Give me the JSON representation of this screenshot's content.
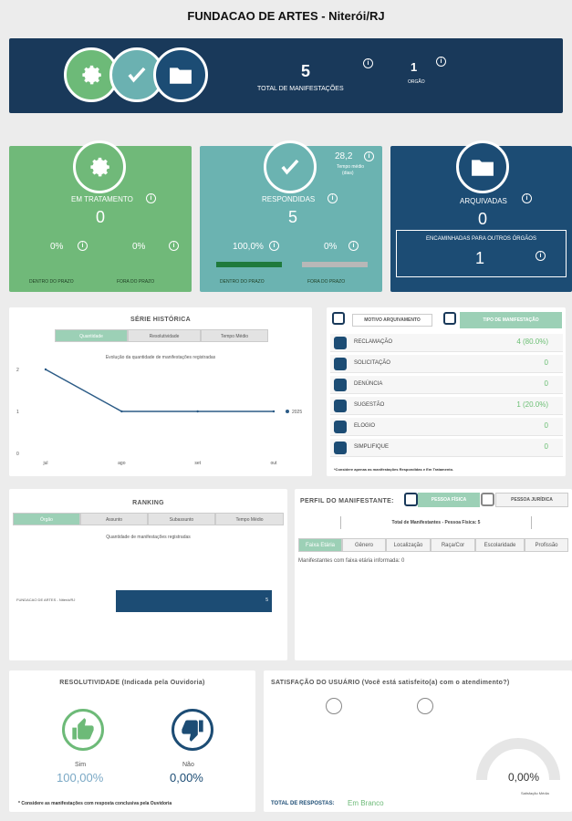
{
  "page_title": "FUNDACAO DE ARTES - Niterói/RJ",
  "header": {
    "total_value": "5",
    "total_label": "TOTAL DE MANIFESTAÇÕES",
    "orgao_value": "1",
    "orgao_label": "ORGÃO",
    "info_glyph": "i"
  },
  "cards": {
    "tratamento": {
      "label": "EM TRATAMENTO",
      "value": "0",
      "pct_dentro": "0%",
      "pct_fora": "0%",
      "dentro_label": "DENTRO DO PRAZO",
      "fora_label": "FORA DO PRAZO"
    },
    "respondidas": {
      "label": "RESPONDIDAS",
      "value": "5",
      "tempo_value": "28,2",
      "tempo_label": "Tempo médio",
      "tempo_unit": "(dias)",
      "pct_dentro": "100,0%",
      "pct_fora": "0%",
      "dentro_label": "DENTRO DO PRAZO",
      "fora_label": "FORA DO PRAZO",
      "dentro_fraction": 1.0,
      "fora_fraction": 0.0
    },
    "arquivadas": {
      "label": "ARQUIVADAS",
      "value": "0",
      "encaminhadas_label": "ENCAMINHADAS PARA OUTROS ÓRGÃOS",
      "encaminhadas_value": "1"
    }
  },
  "serie": {
    "title": "SÉRIE HISTÓRICA",
    "tabs": [
      "Quantidade",
      "Resolutividade",
      "Tempo Médio"
    ],
    "subtitle": "Evolução da quantidade de manifestações registradas"
  },
  "chart_data": {
    "type": "line",
    "categories": [
      "jul",
      "ago",
      "set",
      "out"
    ],
    "series": [
      {
        "name": "2025",
        "values": [
          2,
          1,
          1,
          1
        ],
        "color": "#2b5b86"
      }
    ],
    "ylim": [
      0,
      2
    ],
    "yticks": [
      "2",
      "1",
      "0"
    ],
    "title": "Evolução da quantidade de manifestações registradas"
  },
  "motivo": {
    "tab1": "MOTIVO ARQUIVAMENTO",
    "tab2": "TIPO DE MANIFESTAÇÃO",
    "rows": [
      {
        "label": "RECLAMAÇÃO",
        "value": "4 (80.0%)",
        "icon": "megaphone-icon"
      },
      {
        "label": "SOLICITAÇÃO",
        "value": "0",
        "icon": "document-icon"
      },
      {
        "label": "DENÚNCIA",
        "value": "0",
        "icon": "alert-icon"
      },
      {
        "label": "SUGESTÃO",
        "value": "1 (20.0%)",
        "icon": "chat-icon"
      },
      {
        "label": "ELOGIO",
        "value": "0",
        "icon": "thumbs-up-icon"
      },
      {
        "label": "SIMPLIFIQUE",
        "value": "0",
        "icon": "simplifique-icon"
      }
    ],
    "footnote": "*Considere apenas as manifestações Respondidas e Em Tratamento."
  },
  "ranking": {
    "title": "RANKING",
    "tabs": [
      "Órgão",
      "Assunto",
      "Subassunto",
      "Tempo Médio"
    ],
    "subtitle": "Quantidade de manifestações registradas",
    "bar_label": "FUNDACAO DE ARTES - Niterói/RJ",
    "bar_value": "5"
  },
  "perfil": {
    "title": "PERFIL DO MANIFESTANTE:",
    "pf_label": "PESSOA FÍSICA",
    "pj_label": "PESSOA JURÍDICA",
    "total_label": "Total de Manifestantes - Pessoa Física: 5",
    "tabs": [
      "Faixa Etária",
      "Gênero",
      "Localização",
      "Raça/Cor",
      "Escolaridade",
      "Profissão"
    ],
    "text": "Manifestantes com faixa etária informada: 0"
  },
  "resolutividade": {
    "title": "RESOLUTIVIDADE (Indicada pela Ouvidoria)",
    "sim_label": "Sim",
    "sim_value": "100,00%",
    "nao_label": "Não",
    "nao_value": "0,00%",
    "footnote": "* Considere as manifestações com resposta conclusiva pela Ouvidoria"
  },
  "satisfacao": {
    "title": "SATISFAÇÃO DO USUÁRIO (Você está satisfeito(a) com o atendimento?)",
    "gauge_value": "0,00%",
    "gauge_fraction": 0.0,
    "gauge_label": "Satisfação Média",
    "total_label": "TOTAL DE RESPOSTAS:",
    "total_value": "Em Branco"
  },
  "colors": {
    "navy": "#19395a",
    "green": "#70b979",
    "teal": "#6bb3b1",
    "blue": "#1c4c74"
  }
}
